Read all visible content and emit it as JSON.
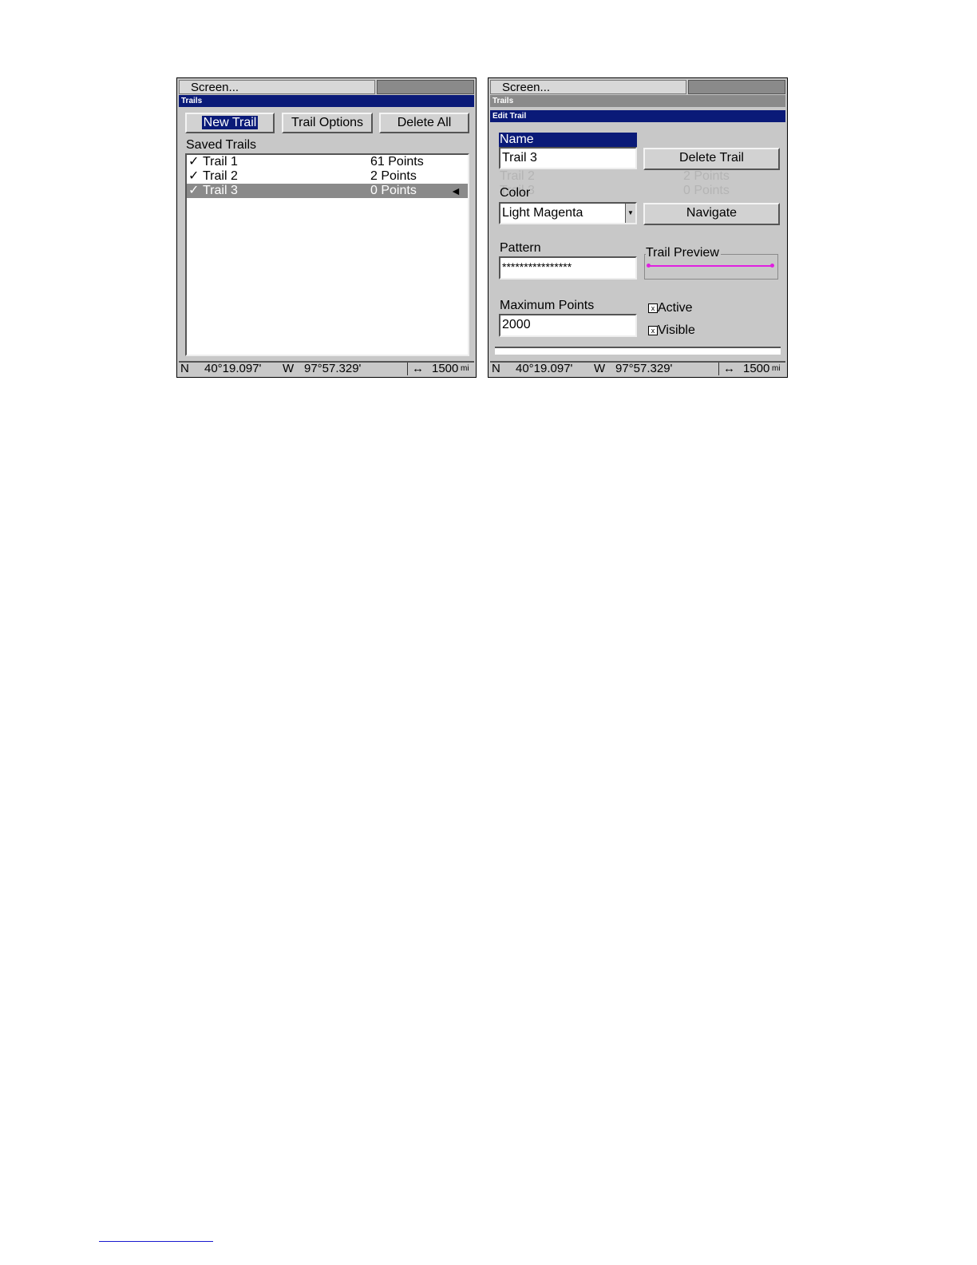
{
  "left_screen": {
    "menu_label": "Screen...",
    "title": "Trails",
    "buttons": {
      "new_trail": "New Trail",
      "trail_options": "Trail Options",
      "delete_all": "Delete All"
    },
    "list_label": "Saved Trails",
    "trails": [
      {
        "check": "✓",
        "name": "Trail 1",
        "points": "61 Points",
        "selected": false
      },
      {
        "check": "✓",
        "name": "Trail 2",
        "points": "2 Points",
        "selected": false
      },
      {
        "check": "✓",
        "name": "Trail 3",
        "points": "0 Points",
        "selected": true
      }
    ],
    "selected_arrow": "◄"
  },
  "right_screen": {
    "menu_label": "Screen...",
    "title_inactive": "Trails",
    "title": "Edit Trail",
    "name_label": "Name",
    "name_value": "Trail 3",
    "delete_trail": "Delete Trail",
    "color_label": "Color",
    "color_value": "Light Magenta",
    "navigate": "Navigate",
    "pattern_label": "Pattern",
    "pattern_value": "****************",
    "trail_preview_label": "Trail Preview",
    "trail_preview_color": "#e020e0",
    "max_points_label": "Maximum Points",
    "max_points_value": "2000",
    "active_label": "Active",
    "active_checked": true,
    "visible_label": "Visible",
    "visible_checked": true,
    "ghost_rows": [
      {
        "name": "Trail 2",
        "points": "2 Points"
      },
      {
        "name": "Trail 3",
        "points": "0 Points"
      }
    ]
  },
  "status": {
    "lat_hemi": "N",
    "lat": "40°19.097'",
    "lon_hemi": "W",
    "lon": "97°57.329'",
    "scale_icon": "↔",
    "scale": "1500",
    "unit": "mi"
  }
}
